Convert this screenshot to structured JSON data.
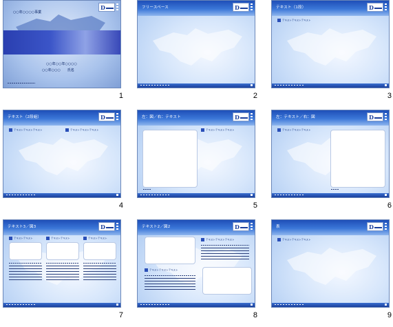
{
  "accent": "#1f4fb8",
  "slides": [
    {
      "number": "1",
      "title": "",
      "title_line1": "○○年○○○○事業",
      "title_line2": "○○年○○年○○○○",
      "title_line3": "○○年○○○　　氏名",
      "layout": "title"
    },
    {
      "number": "2",
      "title": "フリースペース",
      "layout": "blank"
    },
    {
      "number": "3",
      "title": "テキスト（1段）",
      "bullet": "テキストテキストテキスト",
      "layout": "text1"
    },
    {
      "number": "4",
      "title": "テキスト（2段組）",
      "bullet": "テキストテキストテキスト",
      "layout": "text2"
    },
    {
      "number": "5",
      "title": "左：図／右：テキスト",
      "bullet": "テキストテキストテキスト",
      "layout": "imgleft"
    },
    {
      "number": "6",
      "title": "左：テキスト／右：図",
      "bullet": "テキストテキストテキスト",
      "layout": "imgright"
    },
    {
      "number": "7",
      "title": "テキスト3／図3",
      "bullet": "テキストテキスト",
      "layout": "three"
    },
    {
      "number": "8",
      "title": "テキスト2／図2",
      "bullet": "テキストテキストテキスト",
      "layout": "two"
    },
    {
      "number": "9",
      "title": "表",
      "bullet": "テキストテキストテキスト",
      "layout": "table"
    }
  ]
}
